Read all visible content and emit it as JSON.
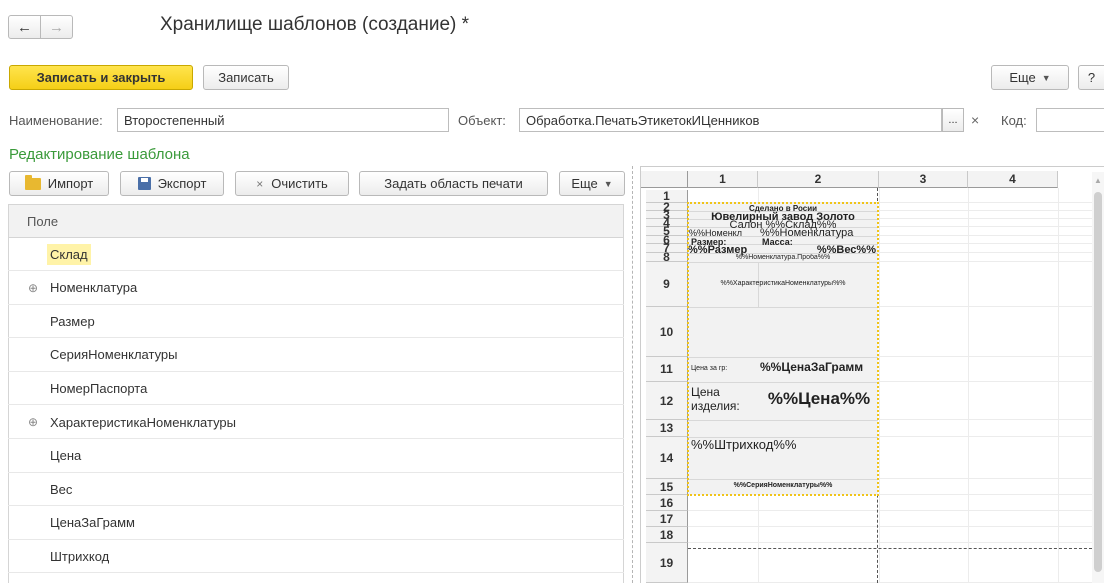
{
  "nav": {
    "back": "←",
    "forward": "→"
  },
  "title": "Хранилище шаблонов (создание) *",
  "toolbar": {
    "save_close": "Записать и закрыть",
    "save": "Записать",
    "more": "Еще",
    "help": "?"
  },
  "form": {
    "name_label": "Наименование:",
    "name_value": "Второстепенный",
    "object_label": "Объект:",
    "object_value": "Обработка.ПечатьЭтикетокИЦенников",
    "object_select": "...",
    "object_clear": "×",
    "code_label": "Код:"
  },
  "section_title": "Редактирование шаблона",
  "editor_toolbar": {
    "import": "Импорт",
    "export": "Экспорт",
    "clear": "Очистить",
    "print_area": "Задать область печати",
    "more": "Еще"
  },
  "fields": {
    "header": "Поле",
    "items": [
      {
        "label": "Склад",
        "expandable": false,
        "selected": true
      },
      {
        "label": "Номенклатура",
        "expandable": true,
        "selected": false
      },
      {
        "label": "Размер",
        "expandable": false,
        "selected": false
      },
      {
        "label": "СерияНоменклатуры",
        "expandable": false,
        "selected": false
      },
      {
        "label": "НомерПаспорта",
        "expandable": false,
        "selected": false
      },
      {
        "label": "ХарактеристикаНоменклатуры",
        "expandable": true,
        "selected": false
      },
      {
        "label": "Цена",
        "expandable": false,
        "selected": false
      },
      {
        "label": "Вес",
        "expandable": false,
        "selected": false
      },
      {
        "label": "ЦенаЗаГрамм",
        "expandable": false,
        "selected": false
      },
      {
        "label": "Штрихкод",
        "expandable": false,
        "selected": false
      }
    ]
  },
  "sheet": {
    "columns": [
      "1",
      "2",
      "3",
      "4"
    ],
    "rows": [
      "1",
      "2",
      "3",
      "4",
      "5",
      "6",
      "7",
      "8",
      "9",
      "10",
      "11",
      "12",
      "13",
      "14",
      "15",
      "16",
      "17",
      "18",
      "19"
    ],
    "cells": {
      "made_in": "Сделано в Росии",
      "factory": "Ювелирный завод Золото",
      "salon": "Салон %%Склад%%",
      "nom_a": "%%Номенкл",
      "nom_b": "%%Номенклатура",
      "size_lbl": "Размер:",
      "mass_lbl": "Масса:",
      "size_val": "Размер%%",
      "weight_val": "%%Вес%%",
      "proba": "%%Номенклатура.Проба%%",
      "char": "%%ХарактеристикаНоменклатуры%%",
      "price_gr_lbl": "Цена за гр:",
      "price_gr_val": "ЦенаЗаГрамм%%",
      "price_lbl_1": "Цена",
      "price_lbl_2": "изделия:",
      "price_val": "%%Цена%%",
      "barcode": "%%Штрихкод%%",
      "serial": "%%СерияНоменклатуры%%"
    }
  },
  "colors": {
    "accent_yellow": "#f5cf17",
    "section_green": "#3a9a3a",
    "selection": "#fff3a8",
    "print_frame": "#f0c419"
  }
}
